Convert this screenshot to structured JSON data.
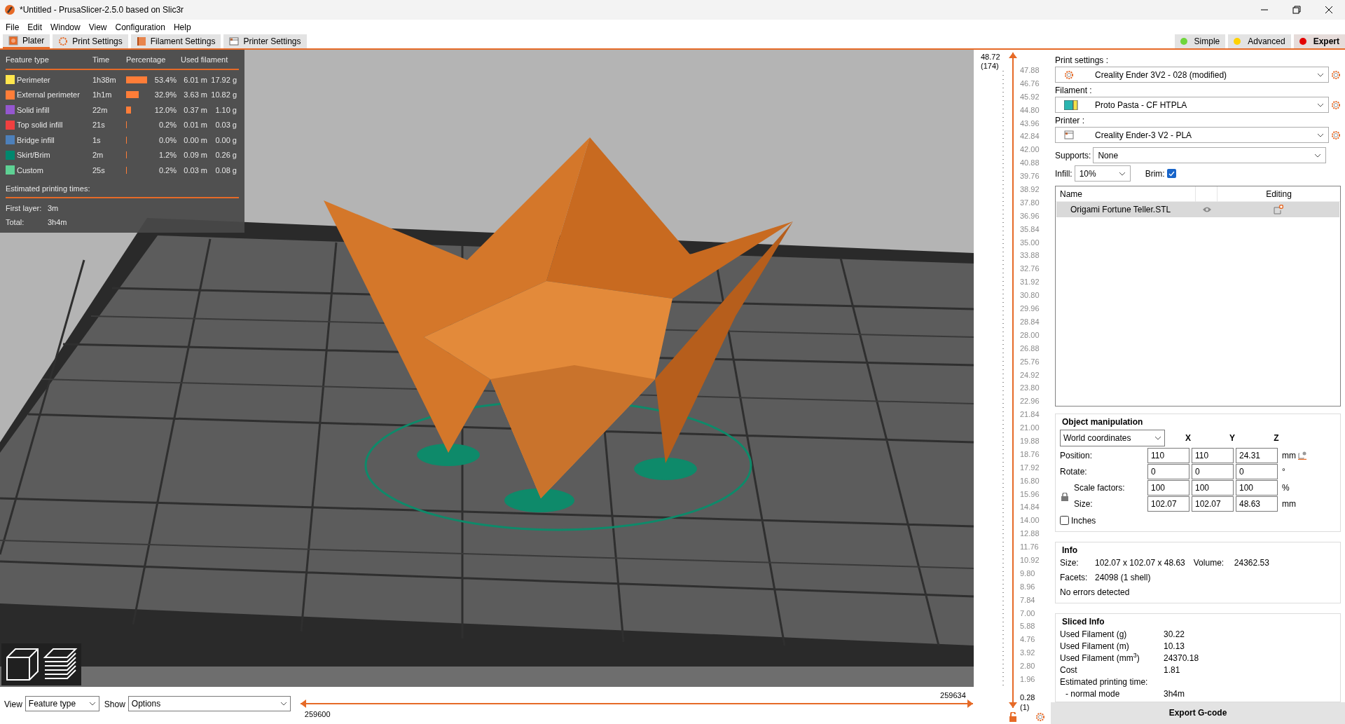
{
  "window": {
    "title": "*Untitled - PrusaSlicer-2.5.0 based on Slic3r"
  },
  "menu": [
    "File",
    "Edit",
    "Window",
    "View",
    "Configuration",
    "Help"
  ],
  "tabs": [
    {
      "label": "Plater",
      "selected": true,
      "kind": "plater"
    },
    {
      "label": "Print Settings",
      "selected": false,
      "kind": "print"
    },
    {
      "label": "Filament Settings",
      "selected": false,
      "kind": "filament"
    },
    {
      "label": "Printer Settings",
      "selected": false,
      "kind": "printer"
    }
  ],
  "modes": [
    {
      "label": "Simple",
      "color": "#6fd63b",
      "selected": false
    },
    {
      "label": "Advanced",
      "color": "#ffd200",
      "selected": false
    },
    {
      "label": "Expert",
      "color": "#e30000",
      "selected": true
    }
  ],
  "legend": {
    "columns": [
      "Feature type",
      "Time",
      "Percentage",
      "Used filament"
    ],
    "rows": [
      {
        "name": "Perimeter",
        "color": "#ffe64d",
        "time": "1h38m",
        "percentage": "53.4%",
        "length": "6.01 m",
        "weight": "17.92 g"
      },
      {
        "name": "External perimeter",
        "color": "#ff7d38",
        "time": "1h1m",
        "percentage": "32.9%",
        "length": "3.63 m",
        "weight": "10.82 g"
      },
      {
        "name": "Solid infill",
        "color": "#9457cf",
        "time": "22m",
        "percentage": "12.0%",
        "length": "0.37 m",
        "weight": "1.10 g"
      },
      {
        "name": "Top solid infill",
        "color": "#f04040",
        "time": "21s",
        "percentage": "0.2%",
        "length": "0.01 m",
        "weight": "0.03 g"
      },
      {
        "name": "Bridge infill",
        "color": "#4d80ba",
        "time": "1s",
        "percentage": "0.0%",
        "length": "0.00 m",
        "weight": "0.00 g"
      },
      {
        "name": "Skirt/Brim",
        "color": "#00876e",
        "time": "2m",
        "percentage": "1.2%",
        "length": "0.09 m",
        "weight": "0.26 g"
      },
      {
        "name": "Custom",
        "color": "#5ed194",
        "time": "25s",
        "percentage": "0.2%",
        "length": "0.03 m",
        "weight": "0.08 g"
      }
    ],
    "times_title": "Estimated printing times:",
    "times": [
      {
        "label": "First layer:",
        "value": "3m"
      },
      {
        "label": "Total:",
        "value": "3h4m"
      }
    ]
  },
  "layer_slider": {
    "upper_thumb": {
      "level": 1
    },
    "top_value": "48.72",
    "top_layer": "(174)",
    "bottom_value": "0.28",
    "bottom_layer": "(1)",
    "ticks": [
      "47.88",
      "46.76",
      "45.92",
      "44.80",
      "43.96",
      "42.84",
      "42.00",
      "40.88",
      "39.76",
      "38.92",
      "37.80",
      "36.96",
      "35.84",
      "35.00",
      "33.88",
      "32.76",
      "31.92",
      "30.80",
      "29.96",
      "28.84",
      "28.00",
      "26.88",
      "25.76",
      "24.92",
      "23.80",
      "22.96",
      "21.84",
      "21.00",
      "19.88",
      "18.76",
      "17.92",
      "16.80",
      "15.96",
      "14.84",
      "14.00",
      "12.88",
      "11.76",
      "10.92",
      "9.80",
      "8.96",
      "7.84",
      "7.00",
      "5.88",
      "4.76",
      "3.92",
      "2.80",
      "1.96"
    ]
  },
  "move_slider": {
    "upper_thumb": {
      "level": 1
    },
    "upper": "259634",
    "lower": "259600"
  },
  "bottom_bar": {
    "view_label": "View",
    "view_value": "Feature type",
    "show_label": "Show",
    "show_value": "Options"
  },
  "presets": [
    {
      "label": "Print settings :",
      "value": "Creality Ender 3V2 - 028 (modified)",
      "kind": "print"
    },
    {
      "label": "Filament :",
      "value": "Proto Pasta - CF HTPLA",
      "kind": "filament"
    },
    {
      "label": "Printer :",
      "value": "Creality Ender-3 V2 - PLA",
      "kind": "printer"
    }
  ],
  "supports": {
    "label": "Supports:",
    "value": "None"
  },
  "infill": {
    "label": "Infill:",
    "value": "10%"
  },
  "brim": {
    "label": "Brim:",
    "checked": true
  },
  "object_list": {
    "columns": [
      "Name",
      "Editing"
    ],
    "rows": [
      {
        "name": "Origami Fortune Teller.STL",
        "selected": true
      }
    ]
  },
  "object_manipulation": {
    "title": "Object manipulation",
    "coordinates": "World coordinates",
    "axes": [
      "X",
      "Y",
      "Z"
    ],
    "rows": [
      {
        "label": "Position:",
        "values": [
          "110",
          "110",
          "24.31"
        ],
        "unit": "mm"
      },
      {
        "label": "Rotate:",
        "values": [
          "0",
          "0",
          "0"
        ],
        "unit": "°"
      },
      {
        "label": "Scale factors:",
        "values": [
          "100",
          "100",
          "100"
        ],
        "unit": "%"
      },
      {
        "label": "Size:",
        "values": [
          "102.07",
          "102.07",
          "48.63"
        ],
        "unit": "mm"
      }
    ],
    "inches": {
      "label": "Inches",
      "checked": false
    }
  },
  "info": {
    "title": "Info",
    "size_label": "Size:",
    "size": "102.07 x 102.07 x 48.63",
    "volume_label": "Volume:",
    "volume": "24362.53",
    "facets_label": "Facets:",
    "facets": "24098 (1 shell)",
    "status": "No errors detected"
  },
  "sliced_info": {
    "title": "Sliced Info",
    "rows": [
      {
        "label": "Used Filament (g)",
        "value": "30.22"
      },
      {
        "label": "Used Filament (m)",
        "value": "10.13"
      },
      {
        "label": "Used Filament (mm$^{3}$)",
        "value": "24370.18"
      },
      {
        "label": "Cost",
        "value": "1.81"
      }
    ],
    "time_title": "Estimated printing time:",
    "time_mode": "- normal mode",
    "time_value": "3h4m"
  },
  "export_button": "Export G-code"
}
